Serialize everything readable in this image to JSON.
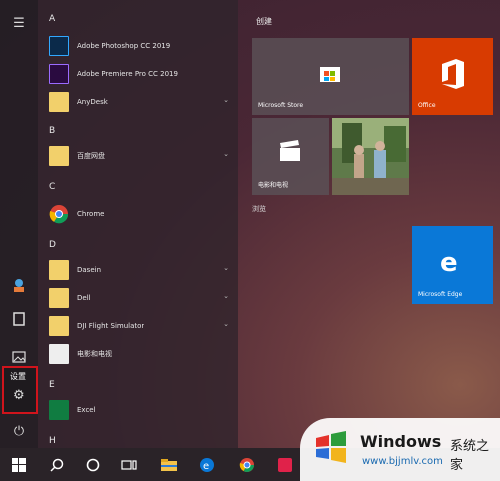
{
  "sidebar": {
    "tooltip_label": "设置"
  },
  "apps": {
    "letter_a": "A",
    "photoshop": "Adobe Photoshop CC 2019",
    "premiere": "Adobe Premiere Pro CC 2019",
    "any_desk": "AnyDesk",
    "letter_b": "B",
    "folder_b1": "百度网盘",
    "letter_c": "C",
    "chrome": "Chrome",
    "letter_d": "D",
    "folder_d1": "Dasein",
    "folder_d2": "Dell",
    "folder_d3": "DJI Flight Simulator",
    "folder_d4": "电影和电视",
    "letter_e": "E",
    "excel": "Excel",
    "letter_h": "H"
  },
  "tiles": {
    "group_title": "创建",
    "group_sub": "浏览",
    "store": "Microsoft Store",
    "office": "Office",
    "movies": "电影和电视",
    "edge": "Microsoft Edge"
  },
  "watermark": {
    "brand": "Windows",
    "cn": "系统之家",
    "url": "www.bjjmlv.com"
  },
  "colors": {
    "office": "#d83b01",
    "edge": "#0a78d7",
    "highlight": "#d0141c"
  }
}
